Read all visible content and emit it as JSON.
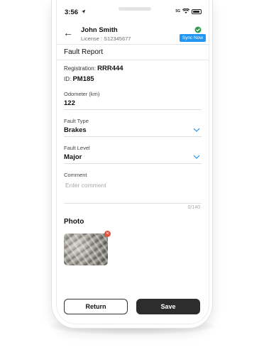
{
  "status_bar": {
    "time": "3:56",
    "signal_text": "5G"
  },
  "header": {
    "driver_name": "John Smith",
    "license": "License : S12345677",
    "sync_label": "Sync Now"
  },
  "form": {
    "title": "Fault Report",
    "registration_label": "Registration:",
    "registration_value": "RRR444",
    "id_label": "ID:",
    "id_value": "PM185",
    "odometer_label": "Odometer (km)",
    "odometer_value": "122",
    "fault_type_label": "Fault Type",
    "fault_type_value": "Brakes",
    "fault_level_label": "Fault Level",
    "fault_level_value": "Major",
    "comment_label": "Comment",
    "comment_placeholder": "Enter comment",
    "comment_counter": "0/140"
  },
  "photo": {
    "title": "Photo"
  },
  "actions": {
    "return_label": "Return",
    "save_label": "Save"
  },
  "colors": {
    "accent": "#2196f3",
    "success": "#2e9d4f",
    "remove": "#e5533c",
    "dark_button": "#2d2d2d"
  }
}
